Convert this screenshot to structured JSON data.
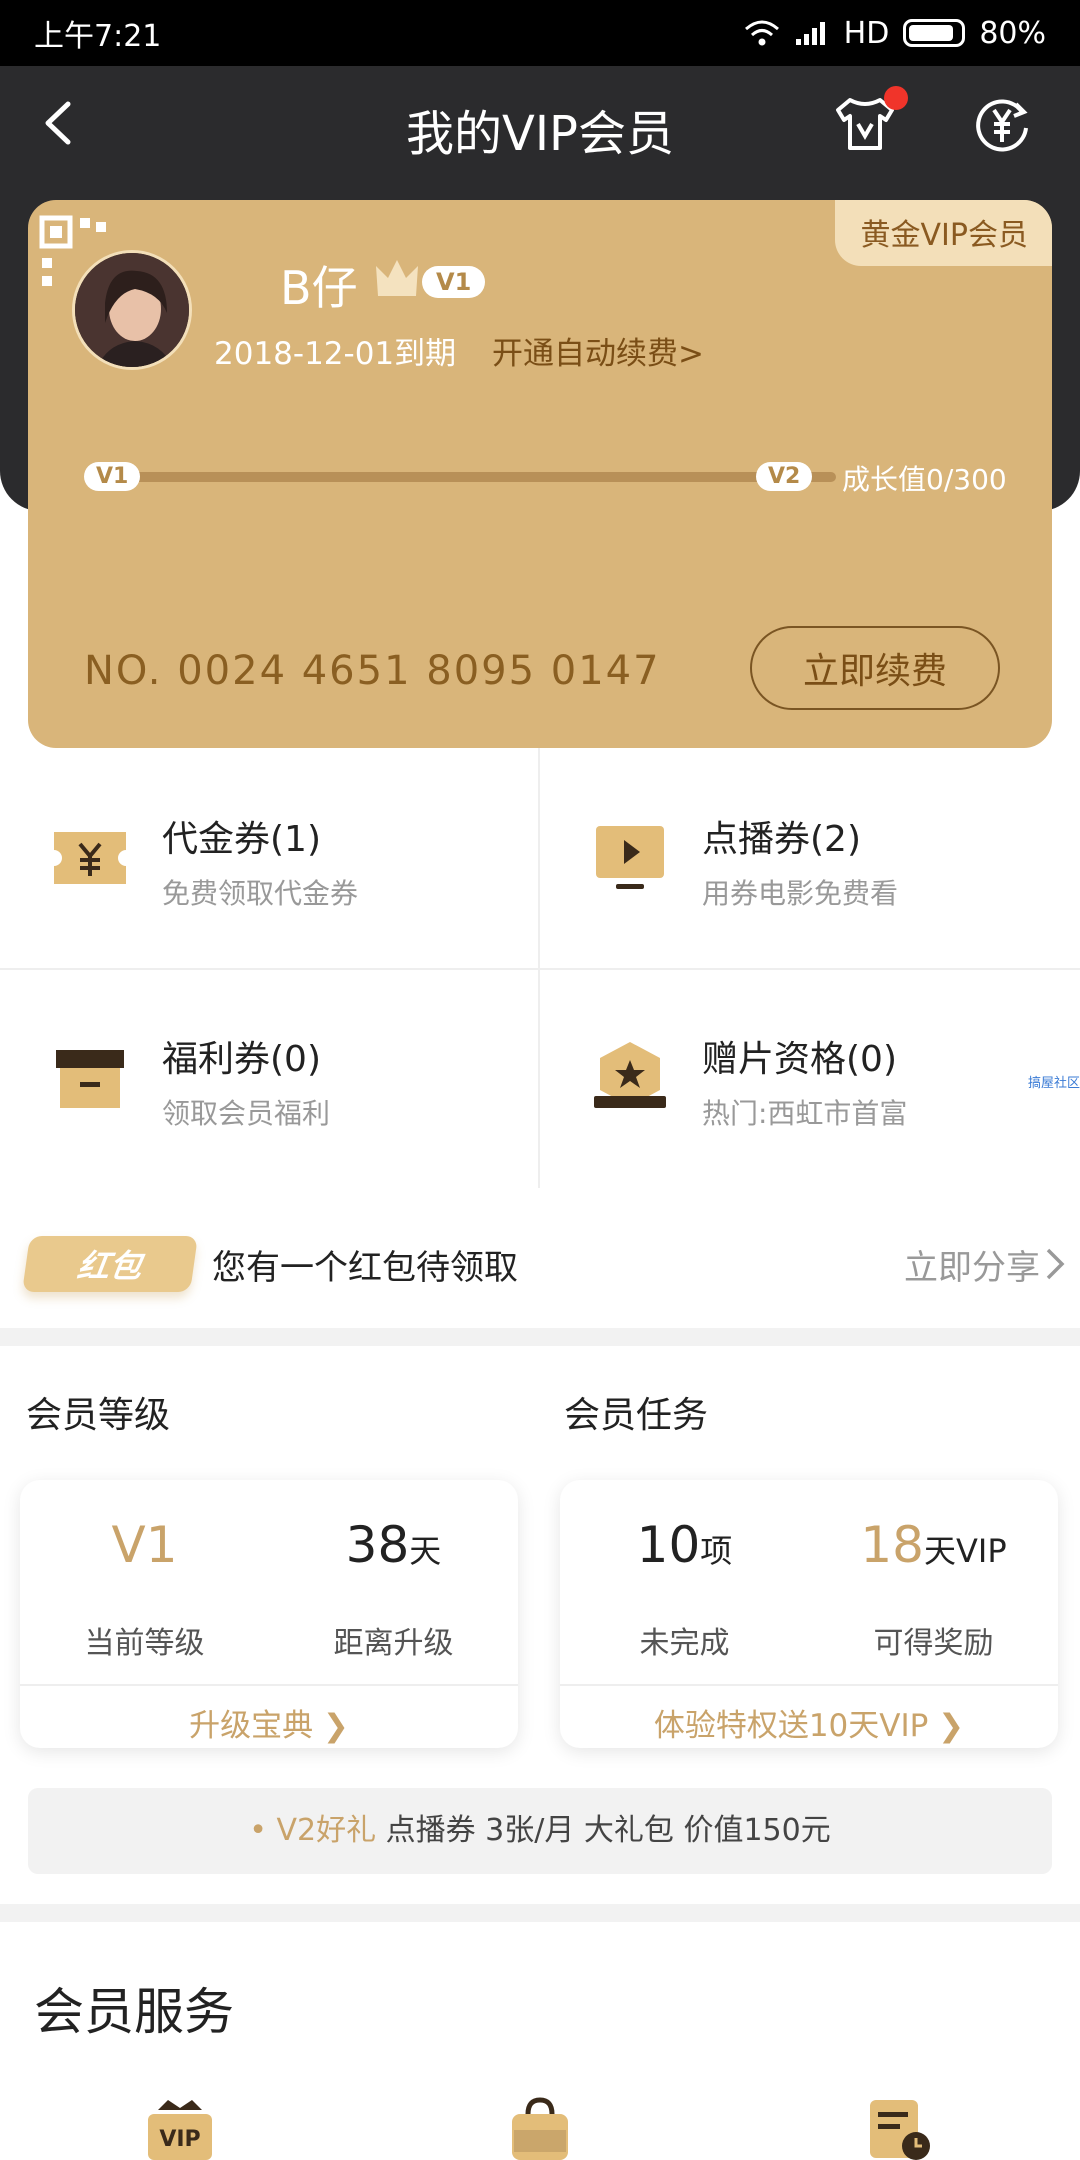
{
  "status_bar": {
    "time": "上午7:21",
    "network": "HD",
    "battery": "80%"
  },
  "header": {
    "title": "我的VIP会员",
    "icons": [
      "back-icon",
      "tshirt-v-icon",
      "yuan-refresh-icon"
    ]
  },
  "card": {
    "tier_tag": "黄金VIP会员",
    "username": "B仔",
    "level_badge": "V1",
    "expire_text": "2018-12-01到期",
    "auto_renew": "开通自动续费>",
    "progress": {
      "from": "V1",
      "to": "V2",
      "growth_text": "成长值0/300",
      "fraction": 0
    },
    "card_no": "NO. 0024 4651 8095 0147",
    "renew_button": "立即续费"
  },
  "coupons": [
    {
      "title": "代金券(1)",
      "sub": "免费领取代金券",
      "icon": "yuan-ticket-icon"
    },
    {
      "title": "点播券(2)",
      "sub": "用券电影免费看",
      "icon": "play-screen-icon"
    },
    {
      "title": "福利券(0)",
      "sub": "领取会员福利",
      "icon": "gift-box-icon"
    },
    {
      "title": "赠片资格(0)",
      "sub": "热门:西虹市首富",
      "icon": "star-badge-icon"
    }
  ],
  "watermark": "搞屋社区",
  "red_packet": {
    "badge": "红包",
    "text": "您有一个红包待领取",
    "action": "立即分享"
  },
  "level_section": {
    "title": "会员等级",
    "current_value": "V1",
    "current_label": "当前等级",
    "days_value": "38",
    "days_unit": "天",
    "days_label": "距离升级",
    "link": "升级宝典 ❯"
  },
  "task_section": {
    "title": "会员任务",
    "incomplete_value": "10",
    "incomplete_unit": "项",
    "incomplete_label": "未完成",
    "reward_value": "18",
    "reward_unit": "天VIP",
    "reward_label": "可得奖励",
    "link": "体验特权送10天VIP ❯"
  },
  "v2_gift": {
    "lead": "• V2好礼",
    "items": " 点播券  3张/月  大礼包  价值150元"
  },
  "services": {
    "title": "会员服务",
    "icons": [
      "vip-bag-icon",
      "jd-bag-icon",
      "document-clock-icon"
    ]
  }
}
